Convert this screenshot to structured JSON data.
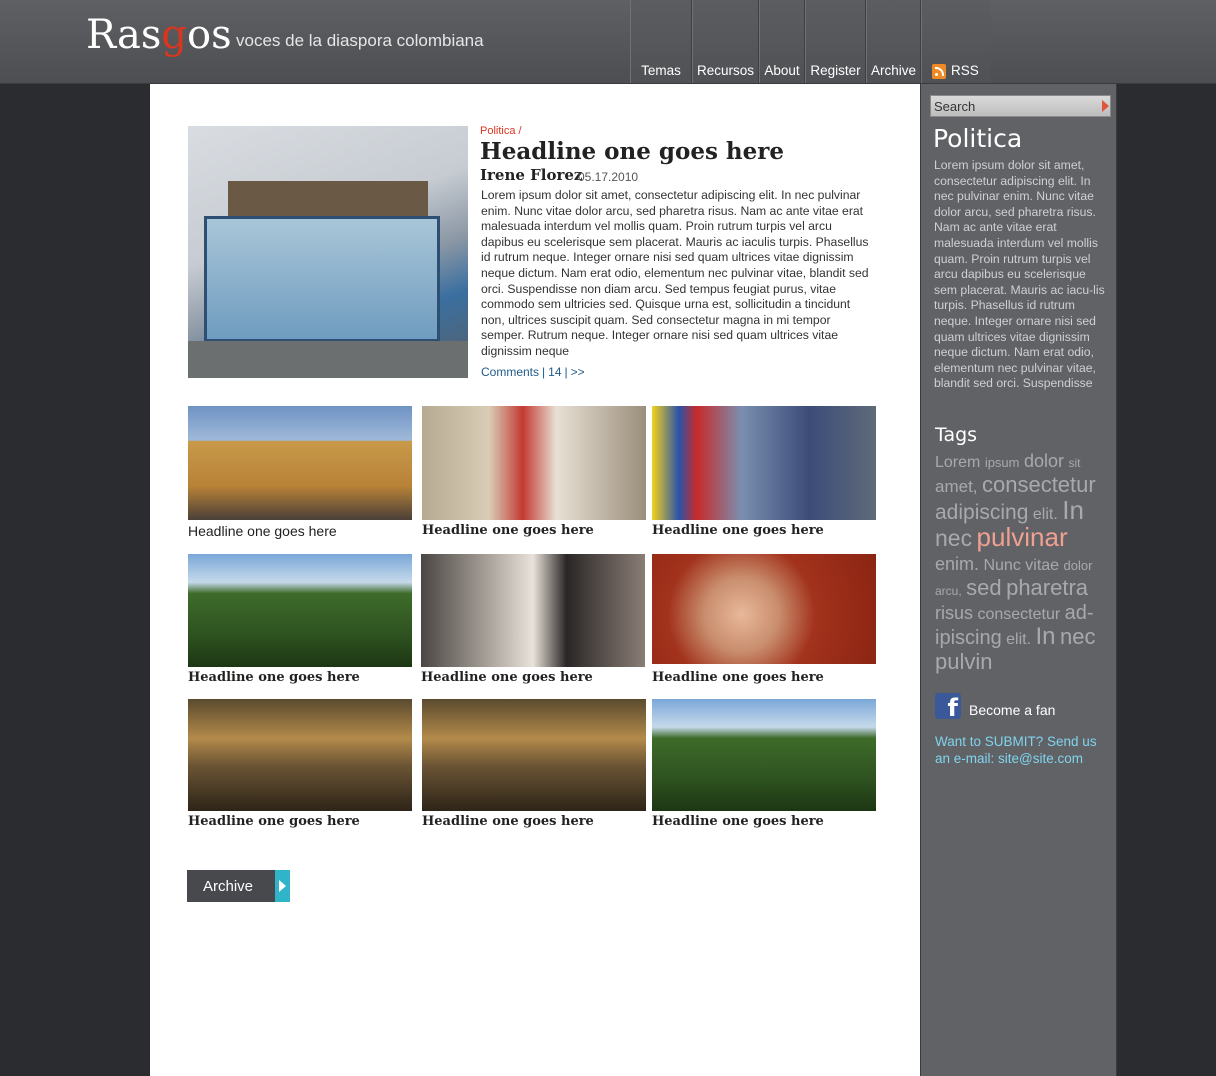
{
  "header": {
    "logo_part1": "Ras",
    "logo_g": "g",
    "logo_part2": "os",
    "tagline": "voces de la diaspora colombiana",
    "nav": [
      "Temas",
      "Recursos",
      "About",
      "Register",
      "Archive"
    ],
    "rss_label": "RSS"
  },
  "feature": {
    "kicker": "Politica /",
    "headline": "Headline one goes here",
    "author": "Irene Florez",
    "date": "05.17.2010",
    "body": "Lorem ipsum dolor sit amet, consectetur adipiscing elit. In nec pulvinar enim. Nunc vitae dolor arcu, sed pharetra risus. Nam ac ante vitae erat malesuada interdum vel mollis quam. Proin rutrum turpis vel arcu dapibus eu scelerisque sem placerat. Mauris ac iaculis turpis. Phasellus id rutrum neque. Integer ornare nisi sed quam ultrices vitae dignissim neque dictum. Nam erat odio, elementum nec pulvinar vitae, blandit sed orci. Suspendisse non diam arcu. Sed tempus feugiat purus, vitae commodo sem ultricies sed. Quisque urna est, sollicitudin a tincidunt non, ultrices suscipit quam. Sed consectetur magna in mi tempor semper. Rutrum neque. Integer ornare nisi sed quam ultrices vitae dignissim neque",
    "comments_label": "Comments",
    "comments_count": "14",
    "more_label": ">>"
  },
  "tiles": [
    {
      "caption": "Headline one goes here"
    },
    {
      "caption": "Headline one goes here"
    },
    {
      "caption": "Headline one goes here"
    },
    {
      "caption": "Headline one goes here"
    },
    {
      "caption": "Headline one goes here"
    },
    {
      "caption": "Headline one goes here"
    },
    {
      "caption": "Headline one goes here"
    },
    {
      "caption": "Headline one goes here"
    },
    {
      "caption": "Headline one goes here"
    }
  ],
  "archive_button": "Archive",
  "sidebar": {
    "search_placeholder": "Search",
    "title": "Politica",
    "text": "Lorem ipsum dolor sit amet, consectetur adipiscing elit. In nec pulvinar enim. Nunc vitae dolor arcu, sed pharetra risus. Nam ac ante vitae erat malesuada interdum vel mollis quam. Proin rutrum turpis vel arcu dapibus eu scelerisque sem placerat. Mauris ac iacu-lis turpis. Phasellus id rutrum neque. Integer ornare nisi sed quam ultrices vitae dignissim neque dictum. Nam erat odio, elementum nec pulvinar vitae, blandit sed orci. Suspendisse",
    "tags_title": "Tags",
    "tags": [
      "Lorem",
      "ipsum",
      "dolor",
      "sit",
      "amet,",
      "consectetur",
      "adipiscing",
      "elit.",
      "In",
      "nec",
      "pulvinar",
      "enim.",
      "Nunc",
      "vitae",
      "dolor",
      "arcu,",
      "sed",
      "pharetra",
      "risus",
      "consectetur",
      "ad-ipiscing",
      "elit.",
      "In",
      "nec",
      "pulvin"
    ],
    "fan_label": "Become a fan",
    "submit_text": "Want to SUBMIT? Send us an e-mail: site@site.com"
  },
  "colors": {
    "accent_red": "#d9361f",
    "accent_cyan": "#2fb4c9",
    "link_blue": "#1f5a8a",
    "highlight_tag": "#f0a090"
  }
}
